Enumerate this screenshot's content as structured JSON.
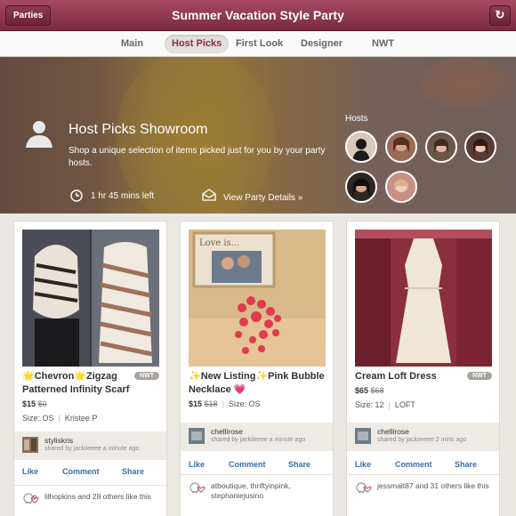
{
  "header": {
    "title": "Summer Vacation Style Party",
    "parties_label": "Parties",
    "refresh_glyph": "↻"
  },
  "tabs": [
    {
      "label": "Main",
      "active": false
    },
    {
      "label": "Host Picks",
      "active": true
    },
    {
      "label": "First Look",
      "active": false
    },
    {
      "label": "Designer",
      "active": false
    },
    {
      "label": "NWT",
      "active": false
    }
  ],
  "showroom": {
    "title": "Host Picks Showroom",
    "description": "Shop a unique selection of items picked just for you by your party hosts.",
    "time_left": "1 hr 45 mins left",
    "details_link": "View Party Details »",
    "hosts_label": "Hosts"
  },
  "hosts": [
    {
      "color": "#d9c9b6"
    },
    {
      "color": "#9a6b55"
    },
    {
      "color": "#6d5547"
    },
    {
      "color": "#5a3a34"
    },
    {
      "color": "#2e2623"
    },
    {
      "color": "#c78f86"
    }
  ],
  "listings": [
    {
      "name": "🌟Chevron🌟Zigzag Patterned Infinity Scarf",
      "nwt": "NWT",
      "price": "$15",
      "original_price": "$0",
      "size": "Size: OS",
      "brand": "Kristee P",
      "sharer": "styliskris",
      "shared_by": "shared by jackiieeee a minute ago",
      "like_label": "Like",
      "comment_label": "Comment",
      "share_label": "Share",
      "likers": "lilhopkins and 28 others like this"
    },
    {
      "name": "✨New Listing✨Pink Bubble Necklace 💗",
      "nwt": "",
      "price": "$15",
      "original_price": "$18",
      "size": "Size: OS",
      "brand": "",
      "sharer": "chellirose",
      "shared_by": "shared by jackiieeee a minute ago",
      "like_label": "Like",
      "comment_label": "Comment",
      "share_label": "Share",
      "likers": "atboutique, thriftyinpink, stephaniejusino"
    },
    {
      "name": "Cream Loft Dress",
      "nwt": "NWT",
      "price": "$65",
      "original_price": "$68",
      "size": "Size: 12",
      "brand": "LOFT",
      "sharer": "chellirose",
      "shared_by": "shared by jackiieeee 2 mins ago",
      "like_label": "Like",
      "comment_label": "Comment",
      "share_label": "Share",
      "likers": "jessmait87 and 31 others like this"
    }
  ],
  "photo_overlay_text": "Love is...",
  "accent": "#8b2c47",
  "link_color": "#3a6ea8",
  "icons": [
    "refresh-icon",
    "person-icon",
    "clock-icon",
    "party-icon",
    "heart-icon"
  ]
}
